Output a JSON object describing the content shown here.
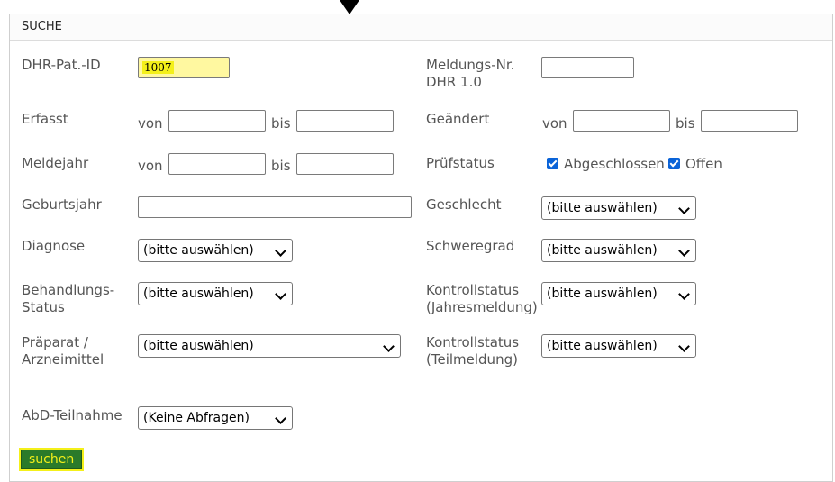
{
  "panel": {
    "title": "SUCHE"
  },
  "fields": {
    "dhr_pat_id": {
      "label": "DHR-Pat.-ID",
      "value": "1007"
    },
    "meldungs_nr": {
      "label_line1": "Meldungs-Nr.",
      "label_line2": "DHR 1.0",
      "value": ""
    },
    "erfasst": {
      "label": "Erfasst",
      "von": "von",
      "bis": "bis"
    },
    "geaendert": {
      "label": "Geändert",
      "von": "von",
      "bis": "bis"
    },
    "meldejahr": {
      "label": "Meldejahr",
      "von": "von",
      "bis": "bis"
    },
    "pruefstatus": {
      "label": "Prüfstatus",
      "options": [
        {
          "label": "Abgeschlossen",
          "checked": true
        },
        {
          "label": "Offen",
          "checked": true
        }
      ]
    },
    "geburtsjahr": {
      "label": "Geburtsjahr",
      "value": ""
    },
    "geschlecht": {
      "label": "Geschlecht",
      "selected": "(bitte auswählen)"
    },
    "diagnose": {
      "label": "Diagnose",
      "selected": "(bitte auswählen)"
    },
    "schweregrad": {
      "label": "Schweregrad",
      "selected": "(bitte auswählen)"
    },
    "behandlungs_status": {
      "label_line1": "Behandlungs-",
      "label_line2": "Status",
      "selected": "(bitte auswählen)"
    },
    "kontrollstatus_jahr": {
      "label_line1": "Kontrollstatus",
      "label_line2": "(Jahresmeldung)",
      "selected": "(bitte auswählen)"
    },
    "praeparat": {
      "label_line1": "Präparat /",
      "label_line2": "Arzneimittel",
      "selected": "(bitte auswählen)"
    },
    "kontrollstatus_teil": {
      "label_line1": "Kontrollstatus",
      "label_line2": "(Teilmeldung)",
      "selected": "(bitte auswählen)"
    },
    "abd_teilnahme": {
      "label": "AbD-Teilnahme",
      "selected": "(Keine Abfragen)"
    }
  },
  "actions": {
    "search_label": "suchen"
  },
  "colors": {
    "highlight": "#f4f01a",
    "button_bg": "#2a7a2a",
    "checkbox": "#0a63d8"
  }
}
